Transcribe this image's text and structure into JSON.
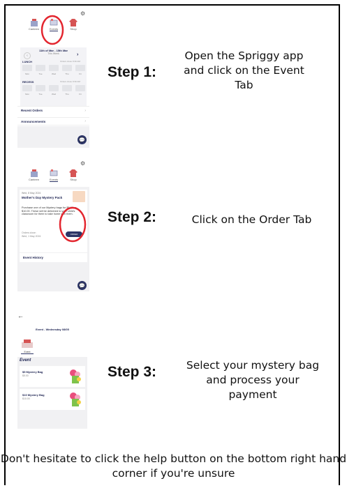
{
  "steps": [
    {
      "label": "Step 1:",
      "text": "Open the Spriggy app and click on the Event Tab"
    },
    {
      "label": "Step 2:",
      "text": "Click on the Order Tab"
    },
    {
      "label": "Step 3:",
      "text": "Select your mystery bag and process your payment"
    }
  ],
  "footer": "Don't hesitate to click the help button on the bottom right hand corner if you're unsure",
  "screen1": {
    "tabs": [
      "Canteen",
      "Events",
      "Shop"
    ],
    "week_range": "11th of Mar - 15th Mar",
    "week_sub": "This Week",
    "lunch_title": "LUNCH",
    "lunch_note": "Orders close 9:30 AM",
    "recess_title": "RECESS",
    "recess_note": "Orders close 9:30 AM",
    "days": [
      "Mon",
      "Tue",
      "Wed",
      "Thu",
      "Fri"
    ],
    "recent_orders": "Recent Orders",
    "announcements": "Announcements"
  },
  "screen2": {
    "tabs": [
      "Canteen",
      "Events",
      "Shop"
    ],
    "date": "Wed, 8 May 2024",
    "title": "Mother's Day Mystery Pack",
    "desc": "Purchase one of our Mystery bags for $5.00 or $10.00. These will be delivered to your child's classroom for them to take home with them.",
    "orders_close_label": "Orders close:",
    "orders_close_date": "Wed, 1 May 2024",
    "order_button": "ORDER",
    "event_history": "Event History"
  },
  "screen3": {
    "header": "Event - Wednesday 08/05",
    "tab": "Event",
    "section": "Event",
    "items": [
      {
        "name": "$5 Mystery Bag",
        "price": "$5.00"
      },
      {
        "name": "$10 Mystery Bag",
        "price": "$10.00"
      }
    ]
  },
  "colors": {
    "navy": "#2d3566",
    "highlight": "#e3262f"
  },
  "icons": [
    "settings-gear-icon",
    "back-arrow-icon",
    "help-chat-icon",
    "chevron-right-icon",
    "chevron-left-icon"
  ]
}
